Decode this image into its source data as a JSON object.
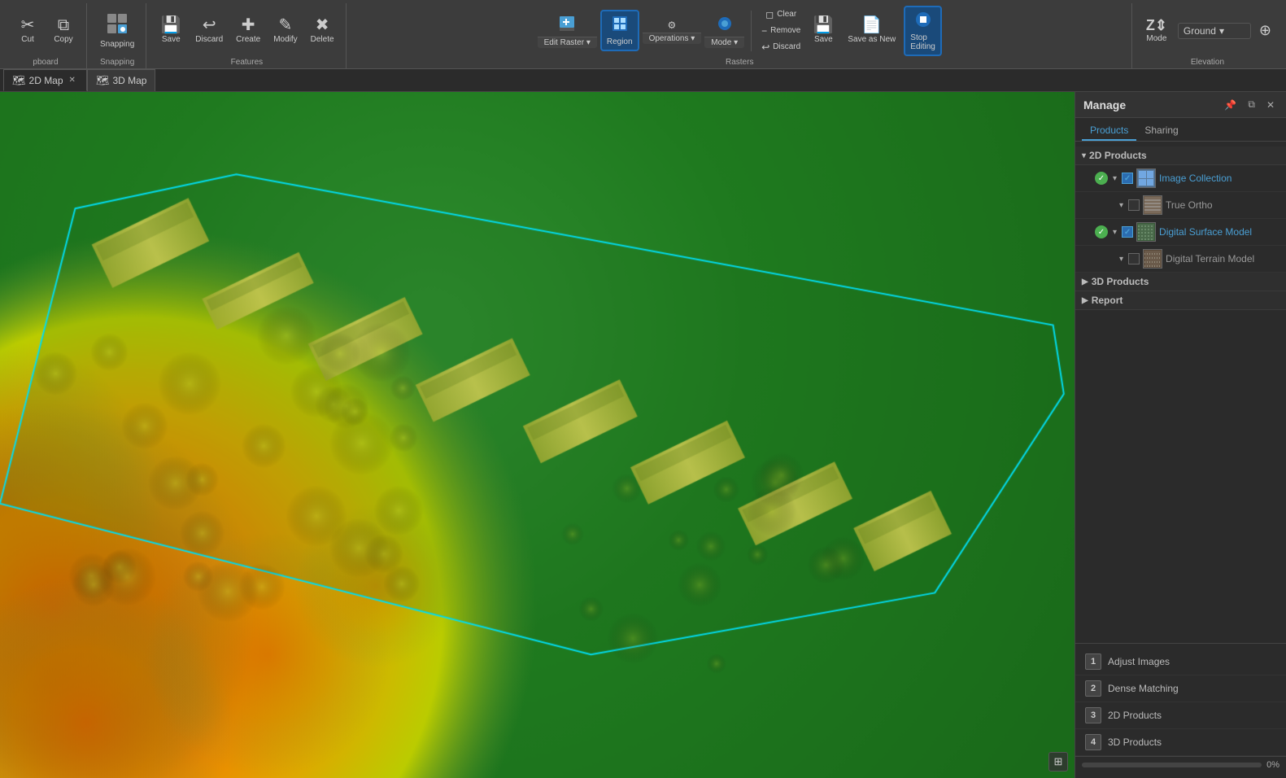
{
  "toolbar": {
    "groups": [
      {
        "name": "clipboard",
        "label": "pboard",
        "items": [
          {
            "id": "cut",
            "icon": "✂",
            "label": "Cut"
          },
          {
            "id": "copy",
            "icon": "⧉",
            "label": "Copy"
          }
        ]
      },
      {
        "name": "snapping",
        "label": "Snapping",
        "items": [
          {
            "id": "snapping",
            "icon": "⊞",
            "label": "Snapping"
          }
        ]
      },
      {
        "name": "features",
        "label": "Features",
        "items": [
          {
            "id": "save",
            "icon": "💾",
            "label": "Save"
          },
          {
            "id": "discard",
            "icon": "↩",
            "label": "Discard"
          },
          {
            "id": "create",
            "icon": "✚",
            "label": "Create"
          },
          {
            "id": "modify",
            "icon": "✎",
            "label": "Modify"
          },
          {
            "id": "delete",
            "icon": "✖",
            "label": "Delete"
          }
        ]
      },
      {
        "name": "rasters",
        "label": "Rasters",
        "items": [
          {
            "id": "edit-raster",
            "icon": "🖊",
            "label": "Edit\nRaster"
          },
          {
            "id": "region",
            "icon": "▦",
            "label": "Region",
            "active": true
          },
          {
            "id": "operations",
            "icon": "⚙",
            "label": "Operations"
          },
          {
            "id": "mode",
            "icon": "◈",
            "label": "Mode"
          },
          {
            "id": "clear",
            "icon": "◻",
            "label": "Clear"
          },
          {
            "id": "remove",
            "icon": "−",
            "label": "Remove"
          },
          {
            "id": "discard2",
            "icon": "↩",
            "label": "Discard"
          },
          {
            "id": "save2",
            "icon": "💾",
            "label": "Save"
          },
          {
            "id": "save-as-new",
            "icon": "📄",
            "label": "Save as\nNew"
          },
          {
            "id": "stop-editing",
            "icon": "⏹",
            "label": "Stop\nEditing",
            "active": true
          }
        ]
      },
      {
        "name": "elevation",
        "label": "Elevation",
        "items": [
          {
            "id": "mode2",
            "icon": "Z↕",
            "label": "Mode"
          },
          {
            "id": "ground-dropdown",
            "label": "Ground",
            "isDropdown": true
          },
          {
            "id": "add-surface",
            "icon": "+",
            "label": ""
          }
        ]
      }
    ]
  },
  "tabs": [
    {
      "id": "2d-map",
      "label": "2D Map",
      "icon": "🗺",
      "active": true,
      "closable": true
    },
    {
      "id": "3d-map",
      "label": "3D Map",
      "icon": "🗺",
      "active": false,
      "closable": false
    }
  ],
  "panel": {
    "title": "Manage",
    "tabs": [
      {
        "id": "products",
        "label": "Products",
        "active": true
      },
      {
        "id": "sharing",
        "label": "Sharing",
        "active": false
      }
    ],
    "sections": [
      {
        "id": "2d-products",
        "label": "2D Products",
        "expanded": true,
        "layers": [
          {
            "id": "image-collection",
            "name": "Image Collection",
            "hasStatus": true,
            "checked": true,
            "indent": 0,
            "thumbType": "grid"
          },
          {
            "id": "true-ortho",
            "name": "True Ortho",
            "hasStatus": false,
            "checked": false,
            "indent": 1,
            "thumbType": "stripe"
          },
          {
            "id": "digital-surface-model",
            "name": "Digital Surface Model",
            "hasStatus": true,
            "checked": true,
            "indent": 0,
            "thumbType": "stripe2"
          },
          {
            "id": "digital-terrain-model",
            "name": "Digital Terrain Model",
            "hasStatus": false,
            "checked": false,
            "indent": 1,
            "thumbType": "stripe3"
          }
        ]
      },
      {
        "id": "3d-products",
        "label": "3D Products",
        "expanded": false,
        "layers": []
      },
      {
        "id": "report",
        "label": "Report",
        "expanded": false,
        "layers": []
      }
    ],
    "workflow": [
      {
        "num": "1",
        "label": "Adjust Images"
      },
      {
        "num": "2",
        "label": "Dense Matching"
      },
      {
        "num": "3",
        "label": "2D Products"
      },
      {
        "num": "4",
        "label": "3D Products"
      }
    ],
    "progress": {
      "value": 0,
      "text": "0%"
    }
  }
}
